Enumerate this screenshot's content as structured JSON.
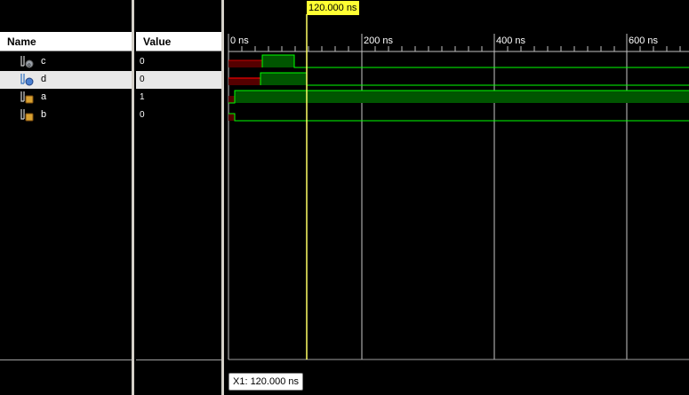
{
  "columns": {
    "name_header": "Name",
    "value_header": "Value"
  },
  "signals": [
    {
      "name": "c",
      "value": "0",
      "icon": "signal-output-icon",
      "selected": false
    },
    {
      "name": "d",
      "value": "0",
      "icon": "signal-output-icon",
      "selected": true
    },
    {
      "name": "a",
      "value": "1",
      "icon": "signal-input-icon",
      "selected": false
    },
    {
      "name": "b",
      "value": "0",
      "icon": "signal-input-icon",
      "selected": false
    }
  ],
  "timeline": {
    "tick_labels": [
      "0 ns",
      "200 ns",
      "400 ns",
      "600 ns"
    ],
    "cursor_label": "120.000 ns",
    "cursor_readout": "X1: 120.000 ns"
  },
  "colors": {
    "background": "#000000",
    "cursor": "#ffff66",
    "waveform_high": "#00ff00",
    "waveform_fill": "#005500",
    "waveform_low_init": "#cc0000",
    "grid": "#c0c0c0"
  }
}
